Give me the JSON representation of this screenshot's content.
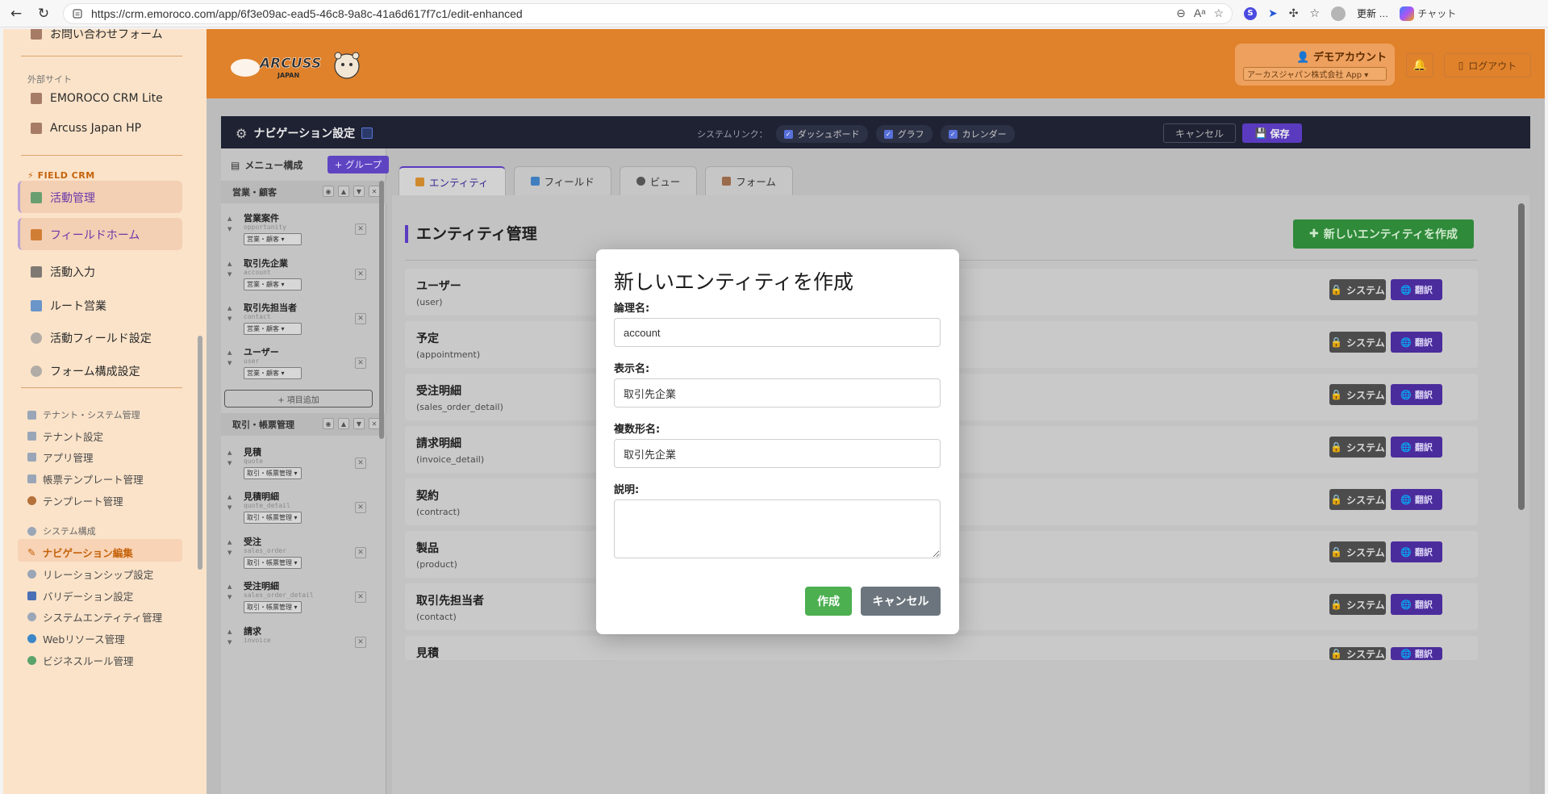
{
  "browser": {
    "url": "https://crm.emoroco.com/app/6f3e09ac-ead5-46c8-9a8c-41a6d617f7c1/edit-enhanced",
    "update_label": "更新",
    "chat_label": "チャット"
  },
  "sidebar": {
    "top_item": "お問い合わせフォーム",
    "external_heading": "外部サイト",
    "external_items": [
      "EMOROCO CRM Lite",
      "Arcuss Japan HP"
    ],
    "field_heading": "FIELD CRM",
    "field_items": [
      "活動管理",
      "フィールドホーム",
      "活動入力",
      "ルート営業",
      "活動フィールド設定",
      "フォーム構成設定"
    ],
    "tenant_heading": "テナント・システム管理",
    "tenant_items": [
      "テナント設定",
      "アプリ管理",
      "帳票テンプレート管理",
      "テンプレート管理"
    ],
    "system_heading": "システム構成",
    "system_items": [
      "ナビゲーション編集",
      "リレーションシップ設定",
      "バリデーション設定",
      "システムエンティティ管理",
      "Webリソース管理",
      "ビジネスルール管理"
    ]
  },
  "header": {
    "logo_text": "ARCUSS",
    "logo_sub": "JAPAN",
    "user_name": "デモアカウント",
    "app_select": "アーカスジャパン株式会社 App",
    "logout_label": "ログアウト"
  },
  "nav_settings": {
    "title": "ナビゲーション設定",
    "system_links_label": "システムリンク：",
    "links": [
      "ダッシュボード",
      "グラフ",
      "カレンダー"
    ],
    "cancel_label": "キャンセル",
    "save_label": "保存"
  },
  "menu_panel": {
    "heading": "メニュー構成",
    "add_group_label": "+ グループ",
    "groups": [
      {
        "name": "営業・顧客",
        "items": [
          {
            "name": "営業案件",
            "code": "opportunity",
            "group": "営業・顧客"
          },
          {
            "name": "取引先企業",
            "code": "account",
            "group": "営業・顧客"
          },
          {
            "name": "取引先担当者",
            "code": "contact",
            "group": "営業・顧客"
          },
          {
            "name": "ユーザー",
            "code": "user",
            "group": "営業・顧客"
          }
        ],
        "add_item_label": "+ 項目追加"
      },
      {
        "name": "取引・帳票管理",
        "items": [
          {
            "name": "見積",
            "code": "quote",
            "group": "取引・帳票管理"
          },
          {
            "name": "見積明細",
            "code": "quote_detail",
            "group": "取引・帳票管理"
          },
          {
            "name": "受注",
            "code": "sales_order",
            "group": "取引・帳票管理"
          },
          {
            "name": "受注明細",
            "code": "sales_order_detail",
            "group": "取引・帳票管理"
          },
          {
            "name": "請求",
            "code": "invoice",
            "group": "取引・帳票管理"
          }
        ]
      }
    ]
  },
  "tabs": [
    "エンティティ",
    "フィールド",
    "ビュー",
    "フォーム"
  ],
  "entity_section": {
    "title": "エンティティ管理",
    "new_button": "新しいエンティティを作成",
    "system_badge": "システム",
    "translate_label": "翻訳",
    "entities": [
      {
        "name": "ユーザー",
        "code": "(user)"
      },
      {
        "name": "予定",
        "code": "(appointment)"
      },
      {
        "name": "受注明細",
        "code": "(sales_order_detail)"
      },
      {
        "name": "請求明細",
        "code": "(invoice_detail)"
      },
      {
        "name": "契約",
        "code": "(contract)"
      },
      {
        "name": "製品",
        "code": "(product)"
      },
      {
        "name": "取引先担当者",
        "code": "(contact)"
      },
      {
        "name": "見積",
        "code": ""
      }
    ]
  },
  "modal": {
    "title": "新しいエンティティを作成",
    "logical_name_label": "論理名:",
    "logical_name_value": "account",
    "display_name_label": "表示名:",
    "display_name_value": "取引先企業",
    "plural_name_label": "複数形名:",
    "plural_name_value": "取引先企業",
    "description_label": "説明:",
    "description_value": "",
    "create_label": "作成",
    "cancel_label": "キャンセル"
  }
}
